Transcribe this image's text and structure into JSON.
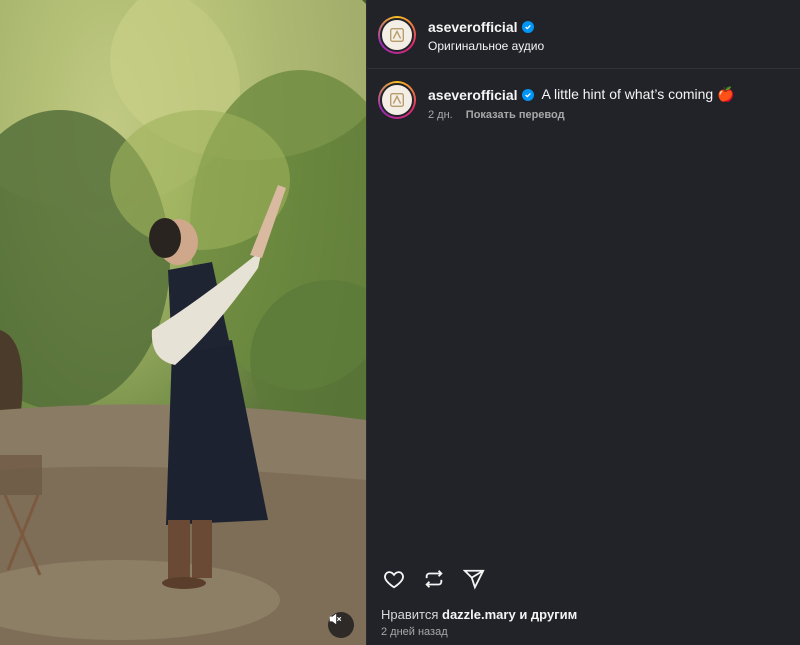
{
  "post": {
    "username": "aseverofficial",
    "audio": "Оригинальное аудио",
    "caption": "A little hint of what’s coming 🍎",
    "age": "2 дн.",
    "translate_label": "Показать перевод",
    "likes_prefix": "Нравится",
    "likes_user": "dazzle.mary",
    "likes_suffix": "и другим",
    "posted": "2 дней назад"
  },
  "icons": {
    "like": "heart-icon",
    "repost": "repost-icon",
    "share": "send-icon",
    "mute": "speaker-muted-icon",
    "verified": "verified-badge-icon"
  },
  "colors": {
    "panel_bg": "#212328",
    "verified": "#0095f6",
    "muted_text": "#a8a8a8"
  }
}
